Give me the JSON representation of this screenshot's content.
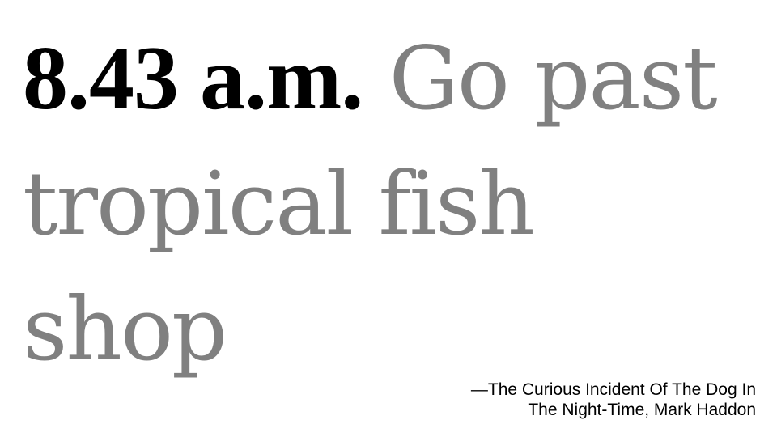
{
  "quote": {
    "time": "8.43 a.m.",
    "text": "Go past tropical fish shop"
  },
  "attribution": {
    "line1": "—The Curious Incident Of The Dog In",
    "line2": "The Night-Time, Mark Haddon"
  },
  "colors": {
    "background": "#ffffff",
    "time_text": "#000000",
    "quote_text": "#808080",
    "attribution_text": "#000000"
  }
}
